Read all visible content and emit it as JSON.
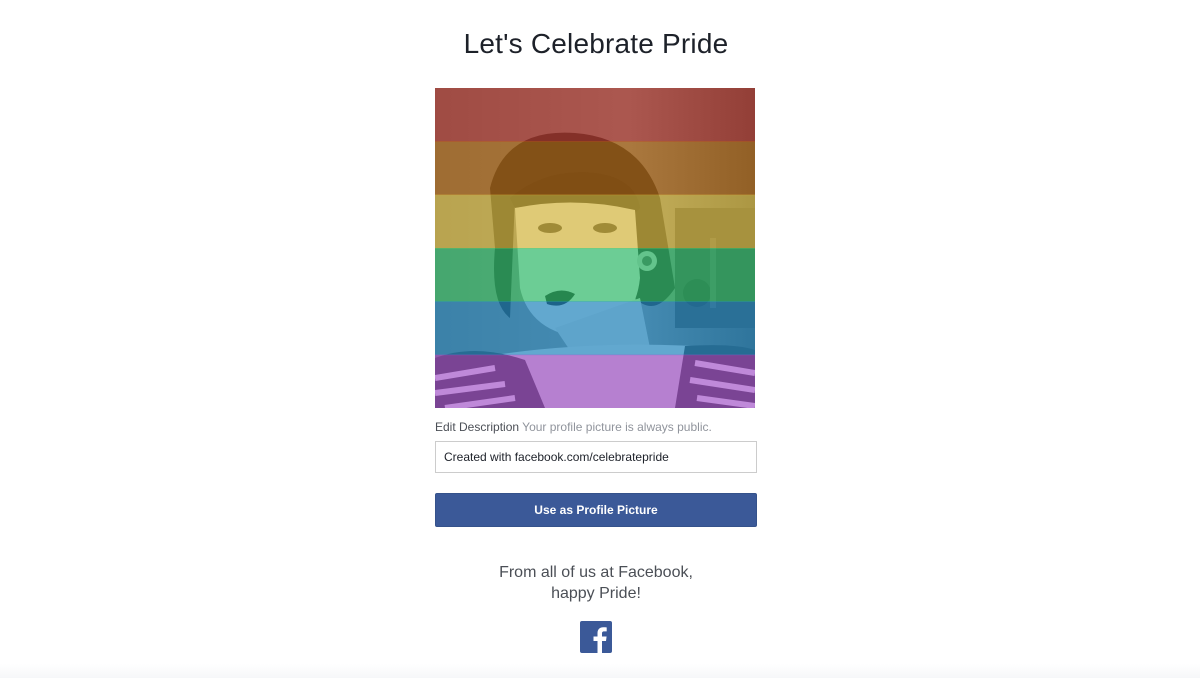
{
  "page": {
    "title": "Let's Celebrate Pride"
  },
  "profile_photo": {
    "overlay_colors": [
      "#c0382b",
      "#bf6d10",
      "#e8c63f",
      "#2ecc71",
      "#1e90cf",
      "#a64fd0"
    ]
  },
  "description": {
    "label": "Edit Description",
    "hint": "Your profile picture is always public.",
    "value": "Created with facebook.com/celebratepride"
  },
  "actions": {
    "use_profile_label": "Use as Profile Picture"
  },
  "closing": {
    "line1": "From all of us at Facebook,",
    "line2": "happy Pride!"
  },
  "brand": {
    "icon": "facebook-icon",
    "color": "#3b5998"
  }
}
